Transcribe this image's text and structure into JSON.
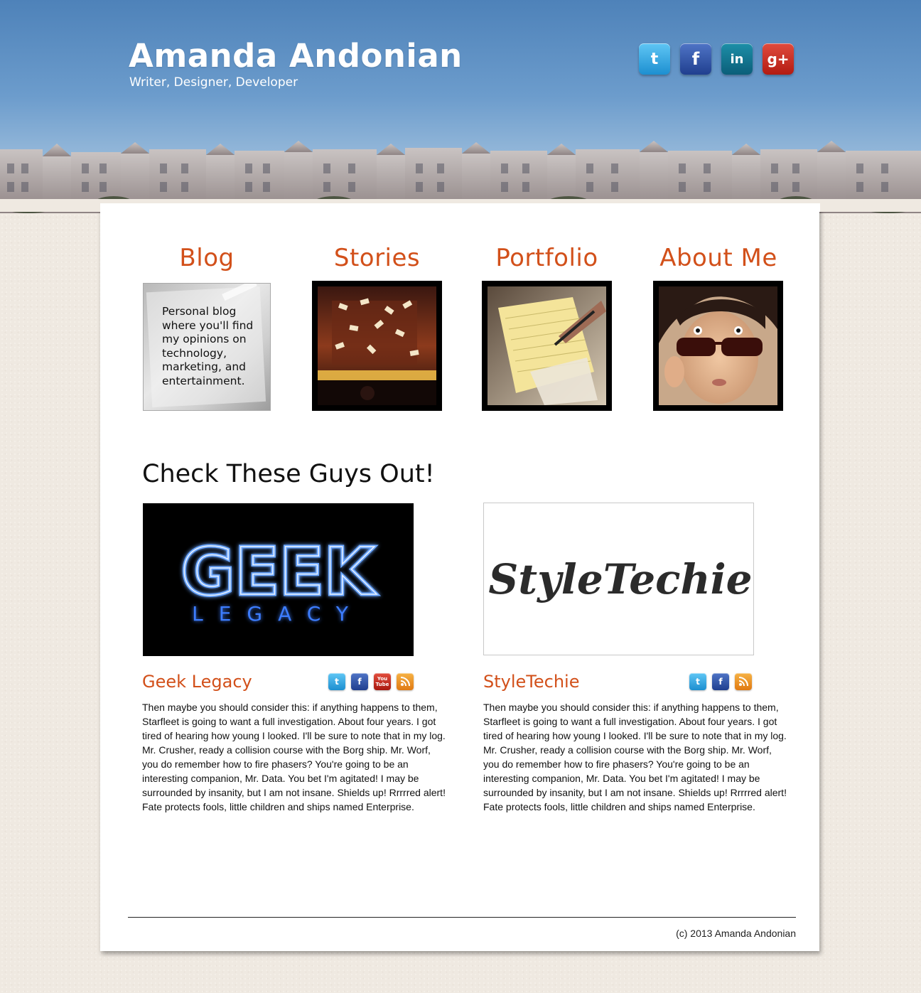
{
  "header": {
    "title": "Amanda Andonian",
    "tagline": "Writer, Designer, Developer",
    "social": [
      {
        "name": "twitter",
        "icon": "twitter-icon",
        "glyph": "t",
        "color": "#1d8fd0"
      },
      {
        "name": "facebook",
        "icon": "facebook-icon",
        "glyph": "f",
        "color": "#203f8f"
      },
      {
        "name": "linkedin",
        "icon": "linkedin-icon",
        "glyph": "in",
        "color": "#0b5e79"
      },
      {
        "name": "google-plus",
        "icon": "google-plus-icon",
        "glyph": "g+",
        "color": "#b31b12"
      }
    ]
  },
  "nav": {
    "blog": {
      "title": "Blog",
      "text": "Personal blog where you'll find my opinions on technology, marketing, and entertainment."
    },
    "stories": {
      "title": "Stories"
    },
    "portfolio": {
      "title": "Portfolio"
    },
    "about": {
      "title": "About Me"
    }
  },
  "friends": {
    "heading": "Check These Guys Out!",
    "geek": {
      "name": "Geek Legacy",
      "logo_main": "GEEK",
      "logo_sub": "LEGACY",
      "icons": [
        "twitter-icon",
        "facebook-icon",
        "youtube-icon",
        "rss-icon"
      ],
      "youtube_label": "You Tube",
      "description": "Then maybe you should consider this: if anything happens to them, Starfleet is going to want a full investigation. About four years. I got tired of hearing how young I looked. I'll be sure to note that in my log. Mr. Crusher, ready a collision course with the Borg ship. Mr. Worf, you do remember how to fire phasers? You're going to be an interesting companion, Mr. Data. You bet I'm agitated! I may be surrounded by insanity, but I am not insane. Shields up! Rrrrred alert! Fate protects fools, little children and ships named Enterprise."
    },
    "styletechie": {
      "name": "StyleTechie",
      "logo_text": "StyleTechie",
      "icons": [
        "twitter-icon",
        "facebook-icon",
        "rss-icon"
      ],
      "description": "Then maybe you should consider this: if anything happens to them, Starfleet is going to want a full investigation. About four years. I got tired of hearing how young I looked. I'll be sure to note that in my log. Mr. Crusher, ready a collision course with the Borg ship. Mr. Worf, you do remember how to fire phasers? You're going to be an interesting companion, Mr. Data. You bet I'm agitated! I may be surrounded by insanity, but I am not insane. Shields up! Rrrrred alert! Fate protects fools, little children and ships named Enterprise."
    }
  },
  "footer": {
    "copyright": "(c) 2013 Amanda Andonian"
  },
  "colors": {
    "accent": "#d2501a",
    "sky_top": "#4e82b9",
    "page_bg": "#efe9e1"
  }
}
